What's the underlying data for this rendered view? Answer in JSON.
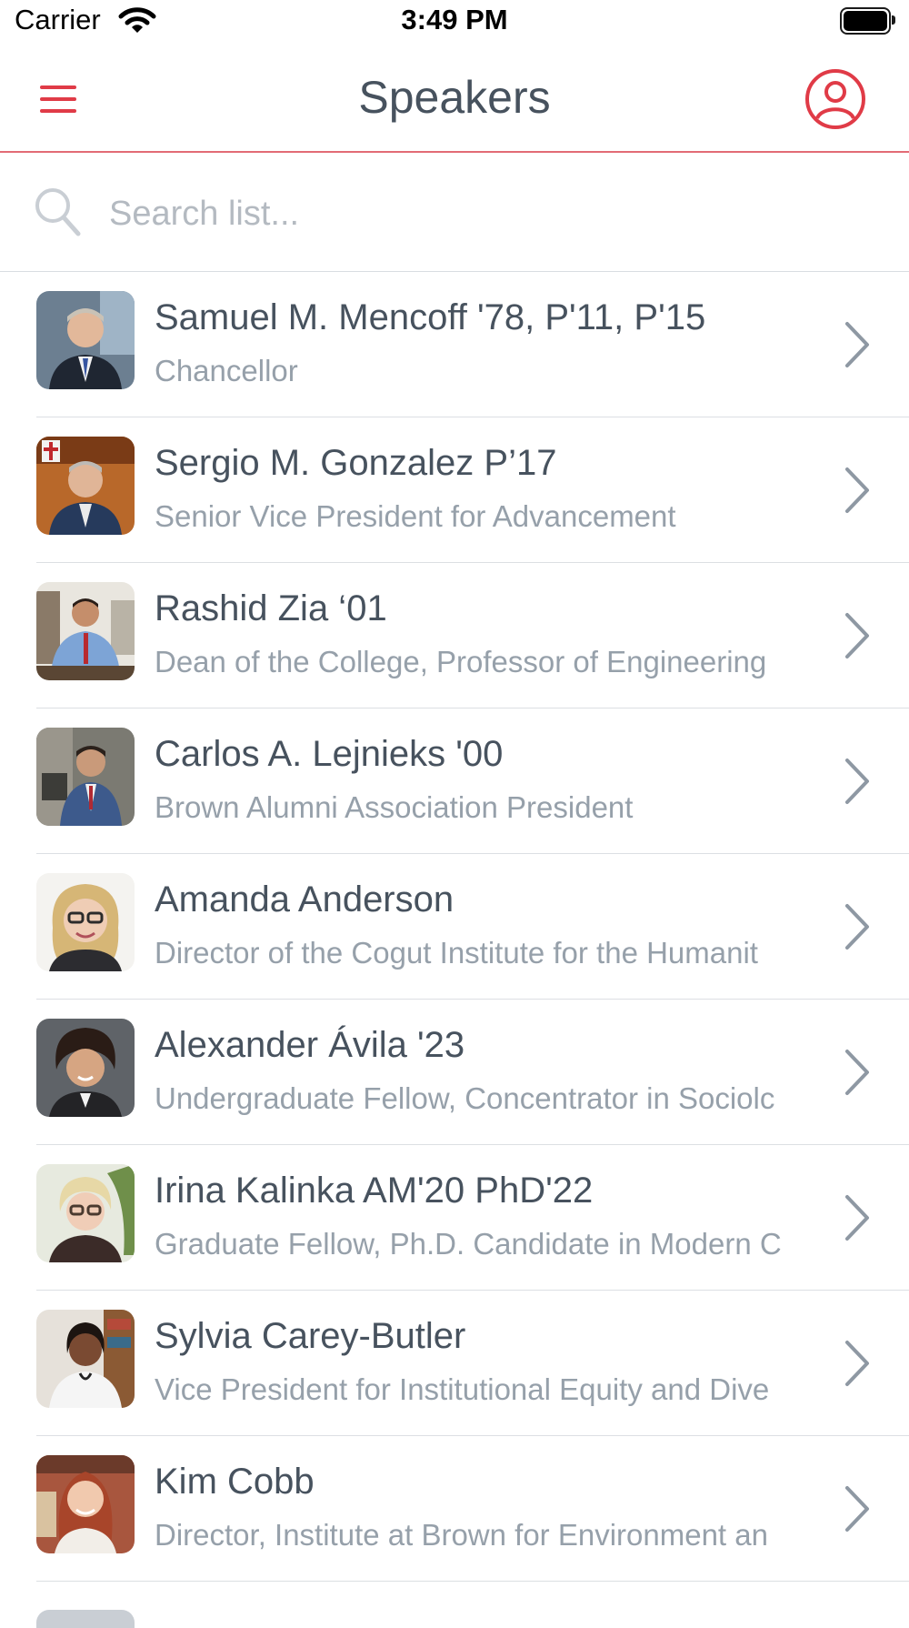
{
  "status_bar": {
    "carrier": "Carrier",
    "time": "3:49 PM"
  },
  "nav": {
    "title": "Speakers",
    "menu_icon": "hamburger-icon",
    "profile_icon": "user-circle-icon"
  },
  "search": {
    "placeholder": "Search list...",
    "value": ""
  },
  "colors": {
    "accent": "#e03b47",
    "divider": "#e26b75",
    "text_primary": "#47525e",
    "text_secondary": "#96a0aa",
    "chevron": "#8e98a3"
  },
  "speakers": [
    {
      "name": "Samuel M. Mencoff '78, P'11, P'15",
      "title": "Chancellor"
    },
    {
      "name": "Sergio M. Gonzalez P’17",
      "title": "Senior Vice President for Advancement"
    },
    {
      "name": "Rashid Zia ‘01",
      "title": "Dean of the College, Professor of Engineering"
    },
    {
      "name": "Carlos A. Lejnieks '00",
      "title": "Brown Alumni Association President"
    },
    {
      "name": "Amanda Anderson",
      "title": "Director of the Cogut Institute for the Humanit"
    },
    {
      "name": "Alexander Ávila '23",
      "title": "Undergraduate Fellow, Concentrator in Sociolc"
    },
    {
      "name": "Irina Kalinka AM'20 PhD'22",
      "title": "Graduate Fellow, Ph.D. Candidate in Modern C"
    },
    {
      "name": "Sylvia Carey-Butler",
      "title": "Vice President for Institutional Equity and Dive"
    },
    {
      "name": "Kim Cobb",
      "title": "Director, Institute at Brown for Environment an"
    }
  ]
}
